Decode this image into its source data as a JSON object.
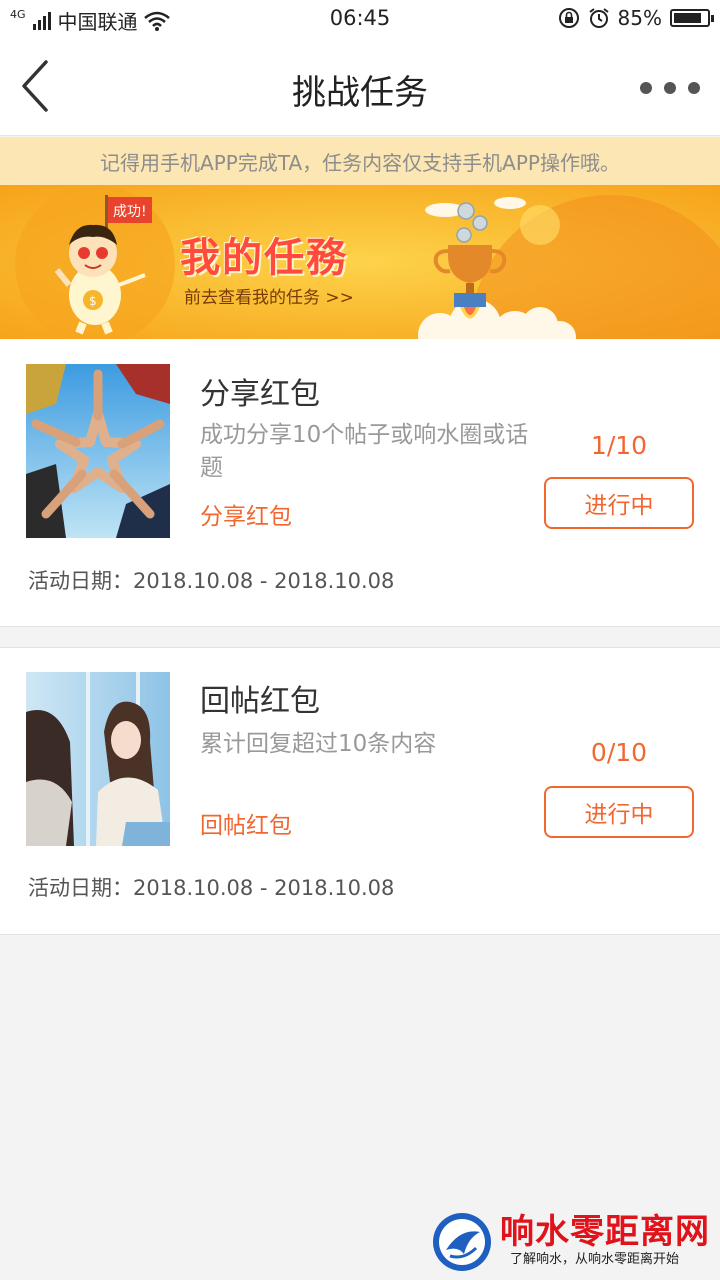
{
  "status_bar": {
    "network": "4G",
    "carrier": "中国联通",
    "time": "06:45",
    "battery": "85%",
    "battery_level": 0.85
  },
  "nav": {
    "title": "挑战任务"
  },
  "notice": "记得用手机APP完成TA，任务内容仅支持手机APP操作哦。",
  "banner": {
    "flag_text": "成功!",
    "title": "我的任務",
    "subtitle": "前去查看我的任务 >>"
  },
  "tasks": [
    {
      "title": "分享红包",
      "description": "成功分享10个帖子或响水圈或话题",
      "tag": "分享红包",
      "progress": "1/10",
      "status": "进行中",
      "date_label": "活动日期：",
      "date_range": "2018.10.08 - 2018.10.08"
    },
    {
      "title": "回帖红包",
      "description": "累计回复超过10条内容",
      "tag": "回帖红包",
      "progress": "0/10",
      "status": "进行中",
      "date_label": "活动日期：",
      "date_range": "2018.10.08 - 2018.10.08"
    }
  ],
  "watermark": {
    "title": "响水零距离网",
    "subtitle": "了解响水，从响水零距离开始"
  },
  "colors": {
    "accent": "#f2672f",
    "notice_bg": "#fbe6b4",
    "banner_bg": "#fbb416",
    "watermark_red": "#e0121a"
  }
}
